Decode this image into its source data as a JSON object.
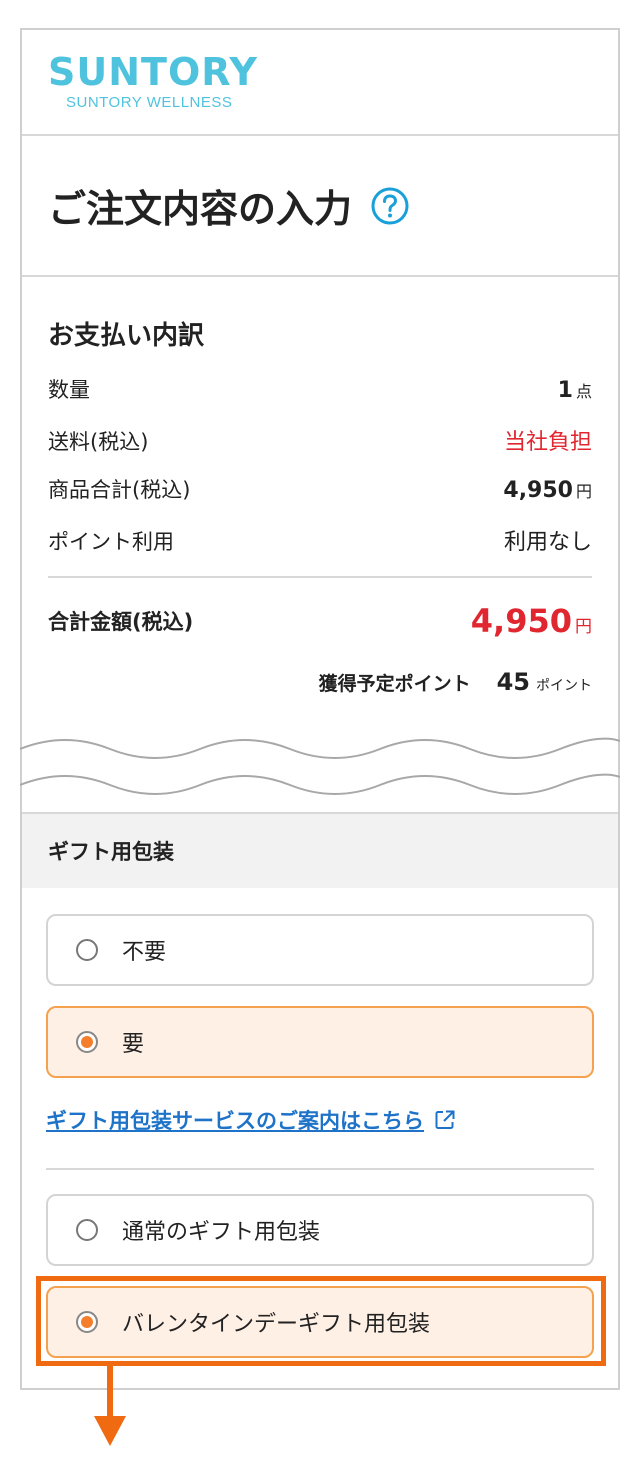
{
  "header": {
    "brand": "SUNTORY",
    "brand_sub": "SUNTORY WELLNESS"
  },
  "page": {
    "title": "ご注文内容の入力",
    "help_icon": "question-circle-icon"
  },
  "payment": {
    "title": "お支払い内訳",
    "rows": [
      {
        "label": "数量",
        "value": "1",
        "unit": "点"
      },
      {
        "label": "送料(税込)",
        "value": "当社負担",
        "unit": ""
      },
      {
        "label": "商品合計(税込)",
        "value": "4,950",
        "unit": "円"
      },
      {
        "label": "ポイント利用",
        "value": "利用なし",
        "unit": ""
      }
    ],
    "total": {
      "label": "合計金額(税込)",
      "value": "4,950",
      "unit": "円"
    },
    "points": {
      "label": "獲得予定ポイント",
      "value": "45",
      "unit": "ポイント"
    }
  },
  "gift": {
    "title": "ギフト用包装",
    "wrap_options": [
      {
        "label": "不要",
        "selected": false
      },
      {
        "label": "要",
        "selected": true
      }
    ],
    "guide_link": "ギフト用包装サービスのご案内はこちら",
    "type_options": [
      {
        "label": "通常のギフト用包装",
        "selected": false
      },
      {
        "label": "バレンタインデーギフト用包装",
        "selected": true
      }
    ]
  },
  "colors": {
    "brand": "#4fc3de",
    "accent_red": "#e0262f",
    "selected_border": "#f4a24f",
    "selected_bg": "#fff0e6",
    "link": "#1e73c8",
    "highlight": "#f06a12"
  }
}
